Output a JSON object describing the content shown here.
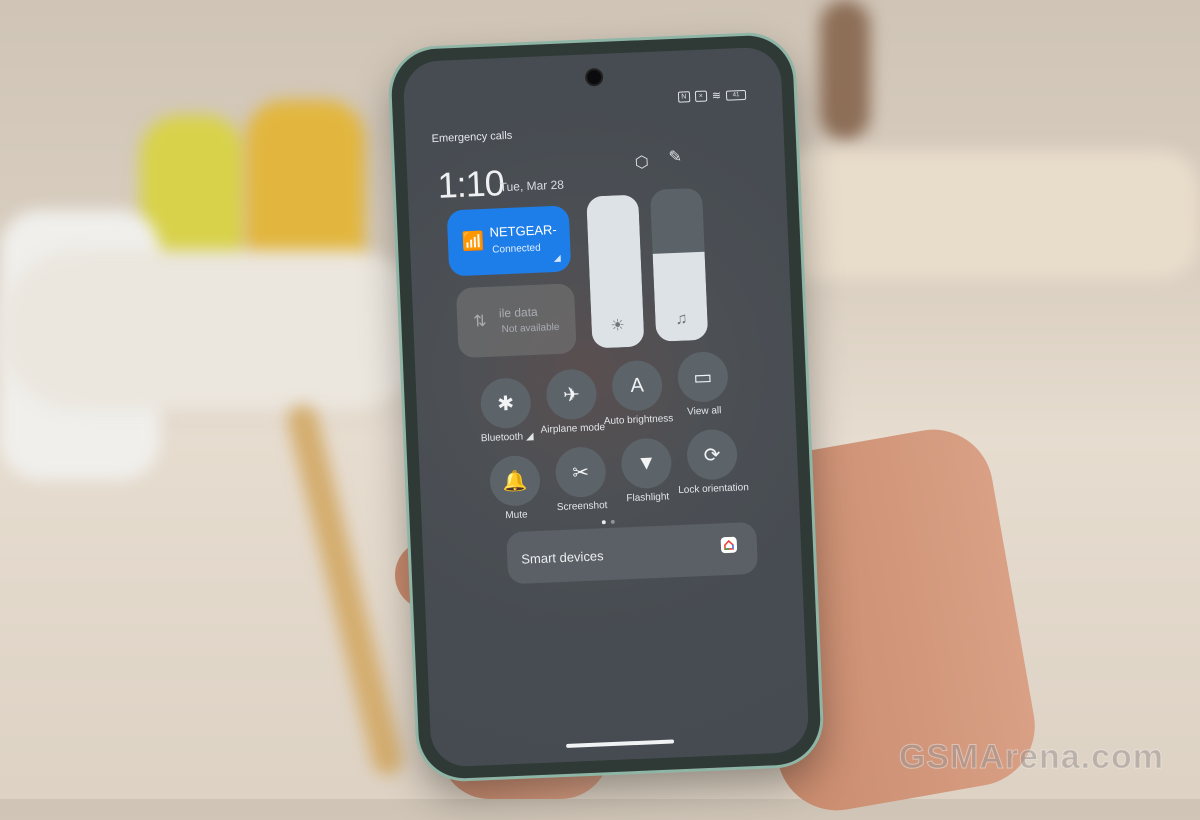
{
  "status_bar": {
    "emergency_text": "Emergency calls",
    "icons": [
      "nfc-icon",
      "no-sim-icon",
      "wifi-icon",
      "battery-icon"
    ],
    "battery_level": "41"
  },
  "header": {
    "time": "1:10",
    "date": "Tue, Mar 28",
    "settings_icon": "gear-icon",
    "edit_icon": "edit-icon"
  },
  "wifi_tile": {
    "network": "NETGEAR-",
    "status": "Connected",
    "accent": "#1e7ee9"
  },
  "data_tile": {
    "label": "ile data",
    "status": "Not available"
  },
  "sliders": {
    "brightness_percent": 100,
    "volume_percent": 58
  },
  "toggles": [
    {
      "label": "Bluetooth ◢",
      "icon": "bluetooth-icon",
      "glyph": "✱"
    },
    {
      "label": "Airplane mode",
      "icon": "airplane-icon",
      "glyph": "✈"
    },
    {
      "label": "Auto brightness",
      "icon": "auto-brightness-icon",
      "glyph": "A"
    },
    {
      "label": "View all",
      "icon": "wallet-icon",
      "glyph": "▭"
    },
    {
      "label": "Mute",
      "icon": "bell-icon",
      "glyph": "🔔"
    },
    {
      "label": "Screenshot",
      "icon": "screenshot-icon",
      "glyph": "✂"
    },
    {
      "label": "Flashlight",
      "icon": "flashlight-icon",
      "glyph": "▼"
    },
    {
      "label": "Lock orientation",
      "icon": "rotation-lock-icon",
      "glyph": "⟳"
    }
  ],
  "page_indicator": {
    "pages": 2,
    "current": 1
  },
  "smart_devices": {
    "label": "Smart devices"
  },
  "watermark": "GSMArena.com"
}
